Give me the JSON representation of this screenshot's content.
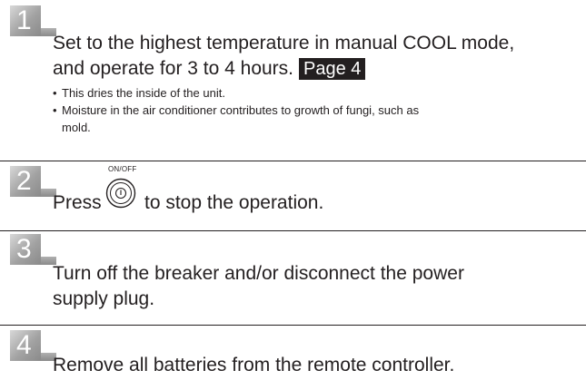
{
  "steps": [
    {
      "number": "1",
      "line1": "Set to the highest temperature in manual COOL mode,",
      "line2": "and operate for 3 to 4 hours.",
      "page_ref": "Page 4",
      "bullets": [
        "This dries the inside of the unit.",
        "Moisture in the air conditioner contributes to growth of fungi, such as",
        "mold."
      ]
    },
    {
      "number": "2",
      "press": "Press",
      "button_label": "ON/OFF",
      "button_icon": "power-button-icon",
      "suffix": "to stop the operation."
    },
    {
      "number": "3",
      "line1": "Turn off the breaker and/or disconnect the power",
      "line2": "supply plug."
    },
    {
      "number": "4",
      "line1": "Remove all batteries from the remote controller."
    }
  ]
}
